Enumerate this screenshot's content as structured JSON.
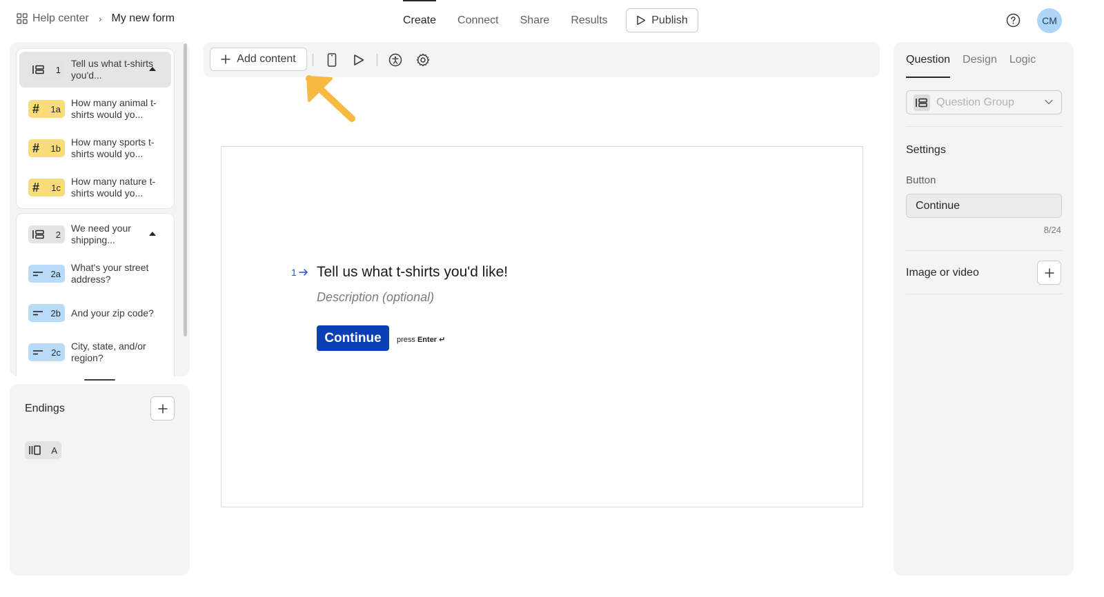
{
  "breadcrumb": {
    "home": "Help center",
    "separator": "›",
    "form_name": "My new form"
  },
  "nav": {
    "tabs": [
      "Create",
      "Connect",
      "Share",
      "Results"
    ],
    "active": "Create",
    "publish_label": "Publish"
  },
  "user": {
    "initials": "CM"
  },
  "questions": {
    "group1": {
      "badge": "1",
      "label": "Tell us what t-shirts you'd...",
      "items": [
        {
          "badge": "1a",
          "label": "How many animal t-shirts would yo..."
        },
        {
          "badge": "1b",
          "label": "How many sports t-shirts would yo..."
        },
        {
          "badge": "1c",
          "label": "How many nature t-shirts would yo..."
        }
      ]
    },
    "group2": {
      "badge": "2",
      "label": "We need your shipping...",
      "items": [
        {
          "badge": "2a",
          "label": "What's your street address?"
        },
        {
          "badge": "2b",
          "label": "And your zip code?"
        },
        {
          "badge": "2c",
          "label": "City, state, and/or region?"
        }
      ]
    }
  },
  "endings": {
    "title": "Endings",
    "items": [
      {
        "badge": "A"
      }
    ]
  },
  "toolbar": {
    "add_content_label": "Add content"
  },
  "canvas": {
    "question_number": "1",
    "question_title": "Tell us what t-shirts you'd like!",
    "description_placeholder": "Description (optional)",
    "continue_label": "Continue",
    "press_label": "press",
    "enter_label": "Enter ↵"
  },
  "right_panel": {
    "tabs": [
      "Question",
      "Design",
      "Logic"
    ],
    "active_tab": "Question",
    "question_type": "Question Group",
    "settings_title": "Settings",
    "button_label": "Button",
    "button_value": "Continue",
    "char_count": "8/24",
    "image_or_video_label": "Image or video"
  },
  "colors": {
    "accent": "#0a3fb5",
    "number_badge": "#f8dd7a",
    "text_badge": "#b9dbfa",
    "group_badge": "#e3e3e3",
    "annotation_arrow": "#f7b942",
    "avatar": "#aed5f7"
  }
}
